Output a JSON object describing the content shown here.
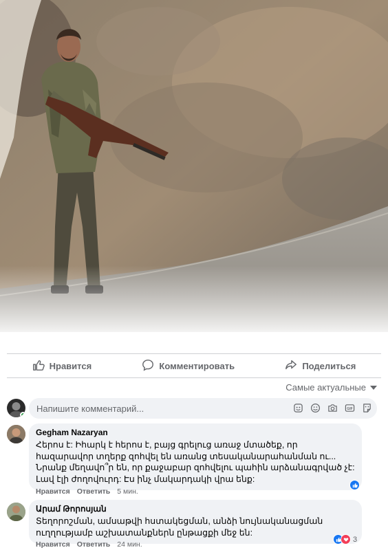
{
  "post": {
    "photo_subject": "soldier-with-rifle"
  },
  "actions": {
    "like": "Нравится",
    "comment": "Комментировать",
    "share": "Поделиться"
  },
  "sort": {
    "label": "Самые актуальные"
  },
  "composer": {
    "placeholder": "Напишите комментарий..."
  },
  "comments": [
    {
      "author": "Gegham Nazaryan",
      "text": "Հերոս է: Իհարկ է հերոս է, բայց գրելուց առաջ մտածեք, որ հազարավոր տղերք զոհվել են առանց տեսականարահանման ու... Նրանք մեղավո՞ր են, որ քաջաբար զոհվելու պահին արձանագրված չէ: Լավ էլի ժողովուրդ: Էս ինչ մակարդակի վրա ենք:",
      "like": "Нравится",
      "reply": "Ответить",
      "time": "5 мин."
    },
    {
      "author": "Արամ Թորոսյան",
      "text": "Տեղորոշման, ամսաթվի հստակեցման, անձի նույնականացման ուղղությամբ աշխատանքներն ընթացքի մեջ են:",
      "like": "Нравится",
      "reply": "Ответить",
      "time": "24 мин.",
      "reaction_count": "3"
    }
  ],
  "colors": {
    "muted": "#65676b",
    "bubble": "#f0f2f5",
    "like_blue": "#1877f2",
    "love_red": "#f33e58",
    "online_green": "#31a24c"
  }
}
